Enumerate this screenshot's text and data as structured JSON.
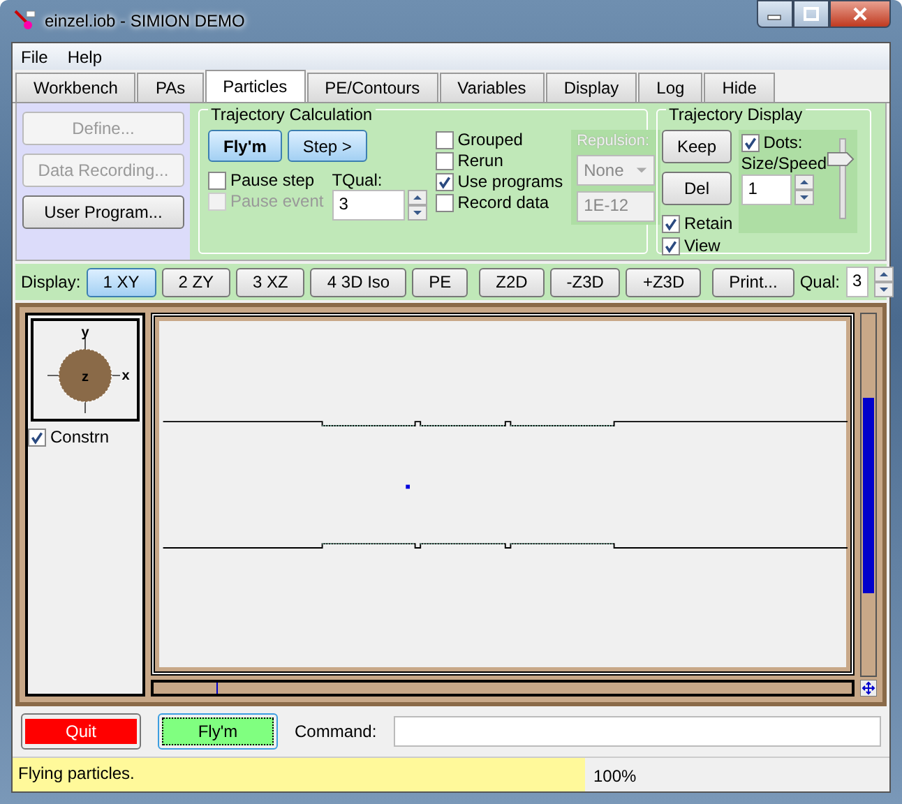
{
  "window": {
    "title": "einzel.iob - SIMION DEMO"
  },
  "menu": [
    "File",
    "Help"
  ],
  "tabs": [
    {
      "label": "Workbench",
      "selected": false
    },
    {
      "label": "PAs",
      "selected": false
    },
    {
      "label": "Particles",
      "selected": true
    },
    {
      "label": "PE/Contours",
      "selected": false
    },
    {
      "label": "Variables",
      "selected": false
    },
    {
      "label": "Display",
      "selected": false
    },
    {
      "label": "Log",
      "selected": false
    },
    {
      "label": "Hide",
      "selected": false
    }
  ],
  "side_buttons": [
    {
      "label": "Define...",
      "disabled": true
    },
    {
      "label": "Data Recording...",
      "disabled": true
    },
    {
      "label": "User Program...",
      "disabled": false
    }
  ],
  "trajectory_calculation": {
    "title": "Trajectory Calculation",
    "buttons": [
      {
        "label": "Fly'm",
        "bold": true
      },
      {
        "label": "Step >",
        "bold": false
      }
    ],
    "pause": [
      {
        "label": "Pause step",
        "checked": false,
        "disabled": false
      },
      {
        "label": "Pause event",
        "checked": false,
        "disabled": true
      }
    ],
    "tqual": {
      "label": "TQual:",
      "value": "3"
    },
    "options": [
      {
        "label": "Grouped",
        "checked": false
      },
      {
        "label": "Rerun",
        "checked": false
      },
      {
        "label": "Use programs",
        "checked": true
      },
      {
        "label": "Record data",
        "checked": false
      }
    ],
    "repulsion": {
      "label": "Repulsion:",
      "value": "None",
      "amount": "1E-12",
      "disabled": true
    }
  },
  "trajectory_display": {
    "title": "Trajectory Display",
    "buttons": [
      "Keep",
      "Del"
    ],
    "checks": [
      {
        "label": "Retain",
        "checked": true
      },
      {
        "label": "View",
        "checked": true
      }
    ],
    "dots": {
      "label": "Dots:",
      "checked": true
    },
    "size_label": "Size/Speed",
    "size_value": "1",
    "level": 0.7
  },
  "display_bar": {
    "label": "Display:",
    "views": [
      {
        "label": "1 XY",
        "selected": true
      },
      {
        "label": "2 ZY",
        "selected": false
      },
      {
        "label": "3 XZ",
        "selected": false
      },
      {
        "label": "4 3D Iso",
        "selected": false
      },
      {
        "label": "PE",
        "selected": false
      }
    ],
    "zoom": [
      "Z2D",
      "-Z3D",
      "+Z3D"
    ],
    "print": "Print...",
    "qual_label": "Qual:",
    "qual_value": "3"
  },
  "view": {
    "axes": [
      "y",
      "z",
      "x"
    ],
    "constrain": {
      "label": "Constrn",
      "checked": true
    }
  },
  "bottom": {
    "quit": "Quit",
    "flym": "Fly'm",
    "command_label": "Command:"
  },
  "status_bar": {
    "message": "Flying particles.",
    "percent": "100%"
  }
}
